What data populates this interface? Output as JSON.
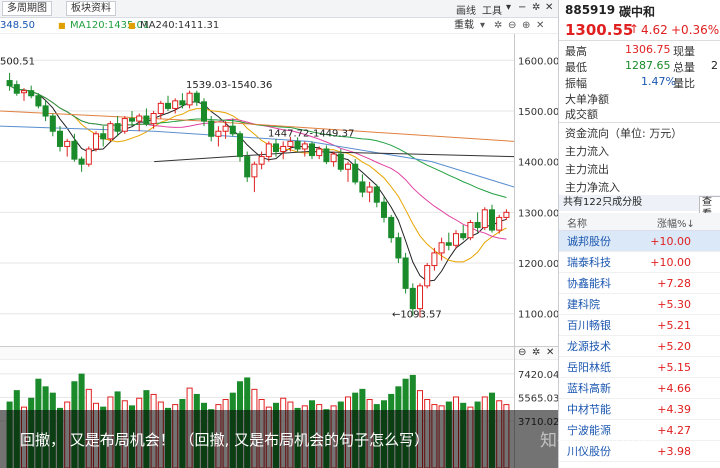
{
  "toolbar": {
    "period_label": "多周期图",
    "block_label": "板块资料",
    "draw_label": "画线",
    "tools_label": "工具",
    "reset_label": "重载"
  },
  "ma_bar": {
    "ma_a": "348.50",
    "ma120": "MA120:1435.01",
    "ma240": "MA240:1411.31"
  },
  "chart_labels": {
    "high_label": "1539.03-1540.36",
    "mid_label": "1447.72-1449.37",
    "low_label": "1093.57",
    "left_top": "500.51"
  },
  "chart_data": {
    "type": "candlestick",
    "y_ticks": [
      1600,
      1500,
      1400,
      1300,
      1200,
      1100
    ],
    "ylim": [
      1060,
      1640
    ],
    "candles": [
      [
        1560,
        1575,
        1540,
        1550
      ],
      [
        1552,
        1560,
        1530,
        1535
      ],
      [
        1536,
        1545,
        1520,
        1540
      ],
      [
        1540,
        1550,
        1525,
        1530
      ],
      [
        1530,
        1535,
        1505,
        1510
      ],
      [
        1510,
        1520,
        1480,
        1490
      ],
      [
        1490,
        1495,
        1450,
        1460
      ],
      [
        1460,
        1470,
        1420,
        1430
      ],
      [
        1430,
        1445,
        1410,
        1440
      ],
      [
        1440,
        1455,
        1400,
        1405
      ],
      [
        1405,
        1410,
        1380,
        1395
      ],
      [
        1395,
        1430,
        1390,
        1425
      ],
      [
        1425,
        1460,
        1420,
        1455
      ],
      [
        1455,
        1470,
        1430,
        1445
      ],
      [
        1445,
        1480,
        1440,
        1475
      ],
      [
        1475,
        1490,
        1450,
        1460
      ],
      [
        1460,
        1490,
        1455,
        1485
      ],
      [
        1485,
        1500,
        1470,
        1480
      ],
      [
        1480,
        1495,
        1460,
        1490
      ],
      [
        1490,
        1505,
        1470,
        1475
      ],
      [
        1475,
        1500,
        1465,
        1495
      ],
      [
        1495,
        1520,
        1485,
        1515
      ],
      [
        1515,
        1530,
        1500,
        1505
      ],
      [
        1505,
        1525,
        1495,
        1520
      ],
      [
        1520,
        1535,
        1505,
        1512
      ],
      [
        1512,
        1540,
        1505,
        1535
      ],
      [
        1535,
        1540,
        1510,
        1518
      ],
      [
        1518,
        1525,
        1470,
        1480
      ],
      [
        1480,
        1490,
        1440,
        1450
      ],
      [
        1450,
        1470,
        1430,
        1460
      ],
      [
        1460,
        1480,
        1445,
        1470
      ],
      [
        1470,
        1485,
        1450,
        1455
      ],
      [
        1455,
        1460,
        1400,
        1410
      ],
      [
        1410,
        1420,
        1360,
        1370
      ],
      [
        1370,
        1400,
        1340,
        1395
      ],
      [
        1395,
        1420,
        1385,
        1410
      ],
      [
        1410,
        1440,
        1400,
        1435
      ],
      [
        1435,
        1445,
        1410,
        1420
      ],
      [
        1420,
        1440,
        1405,
        1430
      ],
      [
        1430,
        1449,
        1420,
        1440
      ],
      [
        1440,
        1448,
        1420,
        1425
      ],
      [
        1425,
        1440,
        1410,
        1435
      ],
      [
        1435,
        1440,
        1405,
        1412
      ],
      [
        1412,
        1430,
        1405,
        1425
      ],
      [
        1425,
        1432,
        1395,
        1400
      ],
      [
        1400,
        1420,
        1390,
        1415
      ],
      [
        1415,
        1425,
        1380,
        1385
      ],
      [
        1385,
        1400,
        1360,
        1395
      ],
      [
        1395,
        1405,
        1355,
        1360
      ],
      [
        1360,
        1375,
        1330,
        1340
      ],
      [
        1340,
        1360,
        1320,
        1350
      ],
      [
        1350,
        1355,
        1310,
        1320
      ],
      [
        1320,
        1330,
        1280,
        1290
      ],
      [
        1290,
        1295,
        1240,
        1250
      ],
      [
        1250,
        1260,
        1200,
        1210
      ],
      [
        1210,
        1220,
        1140,
        1150
      ],
      [
        1150,
        1160,
        1095,
        1110
      ],
      [
        1110,
        1160,
        1093,
        1155
      ],
      [
        1155,
        1200,
        1150,
        1195
      ],
      [
        1195,
        1230,
        1185,
        1220
      ],
      [
        1220,
        1250,
        1205,
        1240
      ],
      [
        1240,
        1260,
        1225,
        1235
      ],
      [
        1235,
        1265,
        1228,
        1258
      ],
      [
        1258,
        1275,
        1245,
        1250
      ],
      [
        1250,
        1285,
        1245,
        1280
      ],
      [
        1280,
        1300,
        1260,
        1270
      ],
      [
        1270,
        1310,
        1265,
        1305
      ],
      [
        1305,
        1315,
        1260,
        1265
      ],
      [
        1265,
        1295,
        1258,
        1290
      ],
      [
        1290,
        1306,
        1285,
        1300
      ]
    ],
    "volumes": [
      5200,
      6100,
      4800,
      5500,
      7000,
      6400,
      5900,
      4700,
      5200,
      6800,
      7400,
      6200,
      5100,
      4800,
      5600,
      6000,
      5300,
      4900,
      5500,
      6100,
      5800,
      5200,
      4700,
      5000,
      5400,
      6300,
      5800,
      5100,
      4600,
      5000,
      5400,
      5900,
      6800,
      7100,
      6200,
      5400,
      4800,
      5100,
      5500,
      5200,
      4700,
      4900,
      5300,
      5000,
      4600,
      4900,
      5200,
      5600,
      5900,
      6200,
      5400,
      5000,
      5300,
      5800,
      6400,
      7000,
      7300,
      6100,
      5400,
      5000,
      4900,
      5200,
      5600,
      5100,
      4800,
      5200,
      5600,
      5900,
      5300,
      5000
    ],
    "volume_ticks": [
      7420.04,
      5565.03,
      3710.02
    ],
    "ma_lines": {
      "ma5_color": "#222222",
      "ma10_color": "#e8a400",
      "ma20_color": "#e040a0",
      "ma60_color": "#20a040",
      "ma120_color": "#5a8fd0",
      "ma240_color": "#e08040"
    }
  },
  "quote": {
    "code": "885919",
    "name": "碳中和",
    "price": "1300.55",
    "arrow": "↑",
    "change": "4.62",
    "pct": "+0.36%",
    "high_label": "最高",
    "high_val": "1306.75",
    "high_label2": "现量",
    "low_label": "最低",
    "low_val": "1287.65",
    "low_label2": "总量",
    "low_extra": "2",
    "amp_label": "振幅",
    "amp_val": "1.47%",
    "amp_label2": "量比",
    "big_label": "大单净额",
    "deal_label": "成交额",
    "flow_title": "资金流向（单位: 万元）",
    "main_in": "主力流入",
    "main_out": "主力流出",
    "main_net": "主力净流入",
    "count_label": "共有122只成分股",
    "view_label": "查看"
  },
  "table": {
    "col_name": "名称",
    "col_pct": "涨幅%↓",
    "rows": [
      {
        "name": "诚邦股份",
        "pct": "+10.00"
      },
      {
        "name": "瑞泰科技",
        "pct": "+10.00"
      },
      {
        "name": "协鑫能科",
        "pct": "+7.28"
      },
      {
        "name": "建科院",
        "pct": "+5.30"
      },
      {
        "name": "百川畅银",
        "pct": "+5.21"
      },
      {
        "name": "龙源技术",
        "pct": "+5.20"
      },
      {
        "name": "岳阳林纸",
        "pct": "+5.15"
      },
      {
        "name": "蓝科高新",
        "pct": "+4.66"
      },
      {
        "name": "中材节能",
        "pct": "+4.39"
      },
      {
        "name": "宁波能源",
        "pct": "+4.27"
      },
      {
        "name": "川仪股份",
        "pct": "+3.98"
      }
    ]
  },
  "banner": {
    "text": "回撤， 又是布局机会！ （回撤, 又是布局机会的句子怎么写）",
    "watermark": "知乎 @TopView"
  }
}
